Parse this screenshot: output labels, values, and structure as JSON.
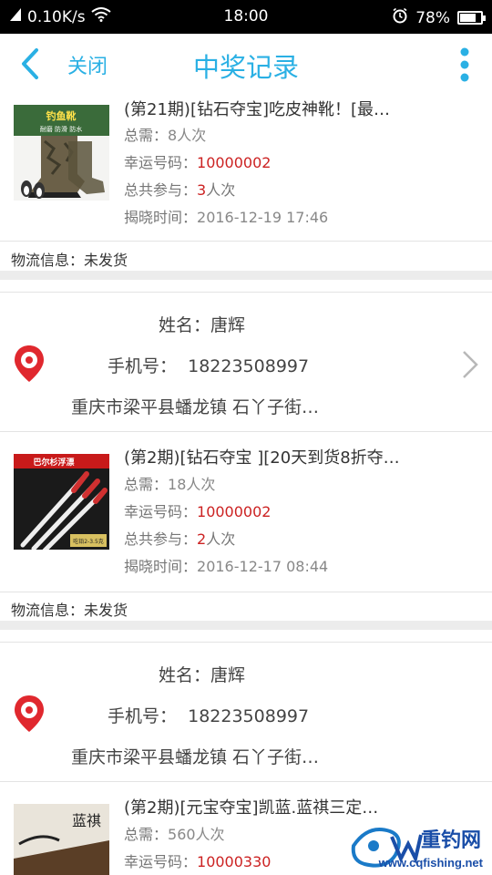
{
  "status_bar": {
    "net_speed": "0.10K/s",
    "time": "18:00",
    "battery": "78%",
    "battery_level": 0.78
  },
  "header": {
    "close_label": "关闭",
    "title": "中奖记录"
  },
  "labels": {
    "need": "总需：",
    "lucky": "幸运号码：",
    "total_join": "总共参与：",
    "reveal_time": "揭晓时间：",
    "logistics": "物流信息：",
    "name": "姓名：",
    "phone": "手机号：",
    "times_suffix": "人次"
  },
  "records": [
    {
      "title": "(第21期)[钻石夺宝]吃皮神靴！[最…",
      "need": "8人次",
      "lucky_number": "10000002",
      "joined": "3",
      "reveal_time": "2016-12-19 17:46",
      "logistics_status": "未发货",
      "thumb_caption_top": "钓鱼靴",
      "thumb_caption_sub": "耐磨 防滑 防水"
    },
    {
      "title": "(第2期)[钻石夺宝 ][20天到货8折夺…",
      "need": "18人次",
      "lucky_number": "10000002",
      "joined": "2",
      "reveal_time": "2016-12-17 08:44",
      "logistics_status": "未发货",
      "thumb_caption_top": "巴尔杉浮漂",
      "thumb_caption_sub": "吃铅2-3.5克"
    },
    {
      "title": "(第2期)[元宝夺宝]凯蓝.蓝祺三定…",
      "need": "560人次",
      "lucky_number": "10000330",
      "thumb_caption_top": "蓝祺"
    }
  ],
  "addresses": [
    {
      "name": "唐辉",
      "phone": "18223508997",
      "address": "重庆市梁平县蟠龙镇 石丫子街…"
    },
    {
      "name": "唐辉",
      "phone": "18223508997",
      "address": "重庆市梁平县蟠龙镇 石丫子街…"
    }
  ],
  "watermark": {
    "brand": "重钓网",
    "url": "www.cqfishing.net"
  },
  "colors": {
    "accent": "#2ab0e4",
    "lucky": "#cc2222",
    "pin": "#e0282e"
  }
}
